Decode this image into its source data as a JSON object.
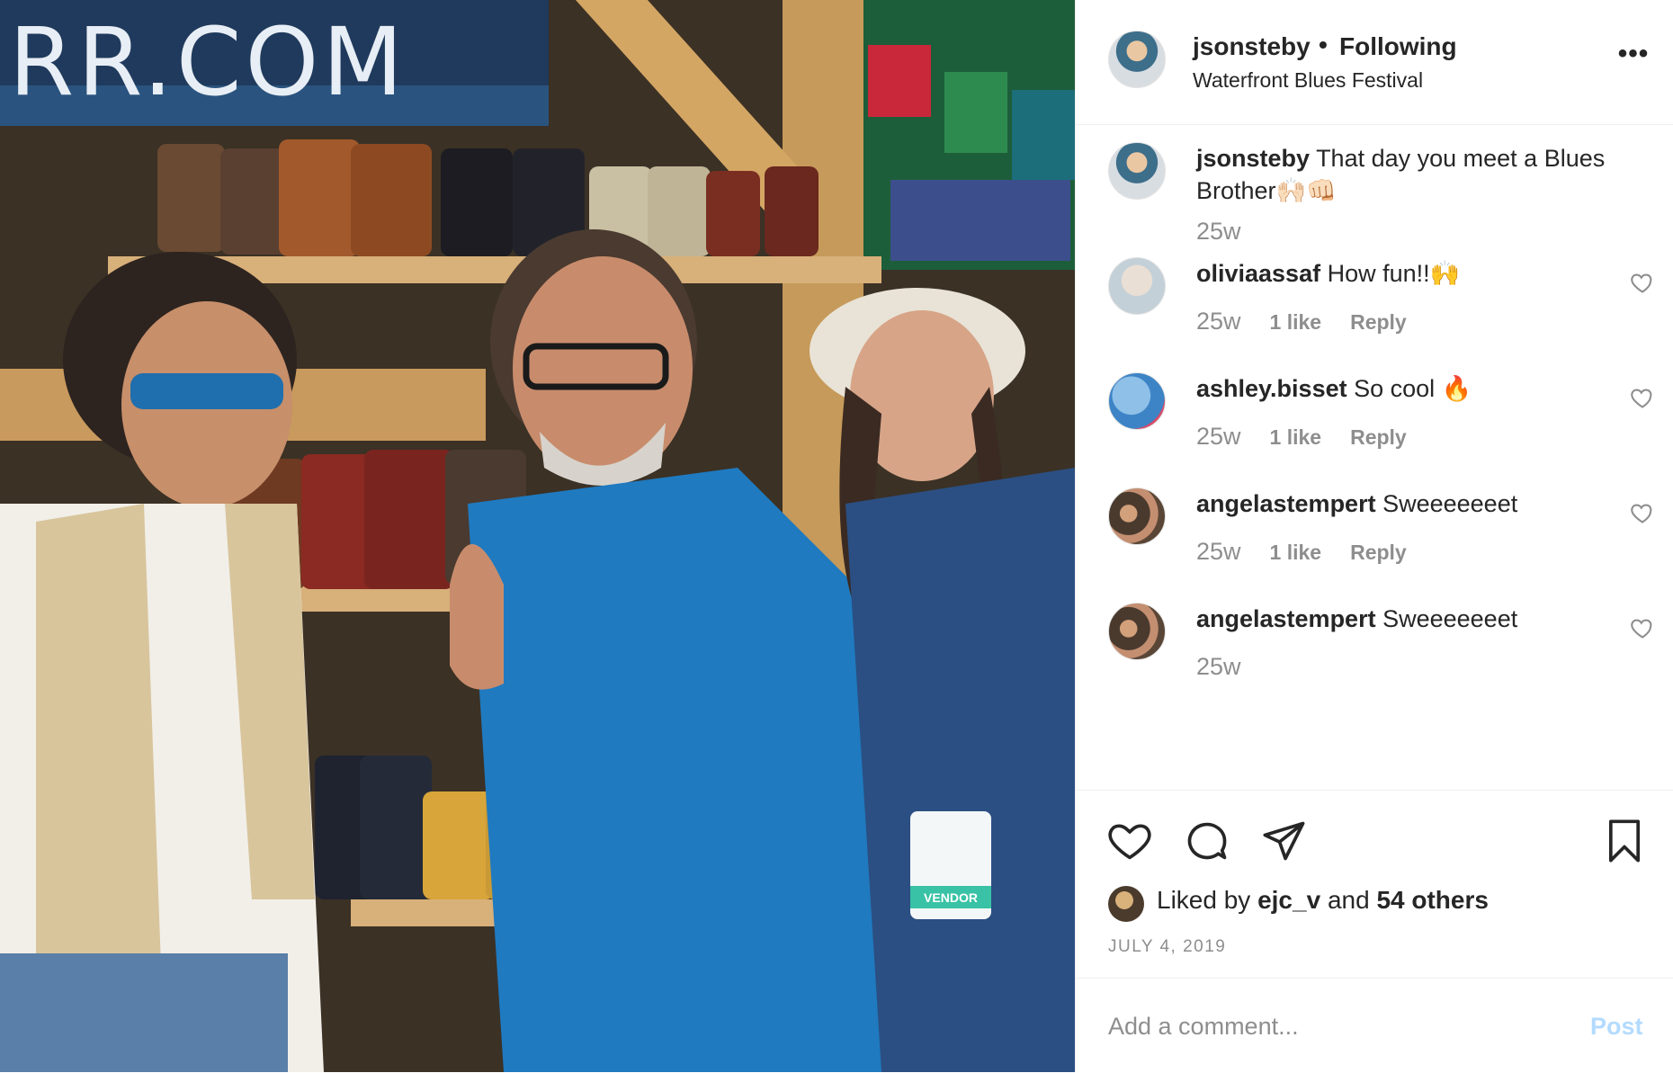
{
  "post": {
    "username": "jsonsteby",
    "separator": "•",
    "following_label": "Following",
    "location": "Waterfront Blues Festival",
    "more_icon": "more-horizontal-icon",
    "more_label": "•••"
  },
  "photo": {
    "sign_text": "RR.COM",
    "badge_text": "VENDOR"
  },
  "caption": {
    "username": "jsonsteby",
    "text": "That day you meet a Blues Brother🙌🏻👊🏻",
    "age": "25w"
  },
  "comments": [
    {
      "username": "oliviaassaf",
      "text": "How fun!!🙌",
      "age": "25w",
      "likes": "1 like",
      "reply": "Reply"
    },
    {
      "username": "ashley.bisset",
      "text": "So cool 🔥",
      "age": "25w",
      "likes": "1 like",
      "reply": "Reply"
    },
    {
      "username": "angelastempert",
      "text": "Sweeeeeeet",
      "age": "25w",
      "likes": "1 like",
      "reply": "Reply"
    },
    {
      "username": "angelastempert",
      "text": "Sweeeeeeet",
      "age": "25w",
      "likes": "",
      "reply": ""
    }
  ],
  "engagement": {
    "liked_by_prefix": "Liked by",
    "liked_by_user": "ejc_v",
    "and": "and",
    "others": "54 others",
    "date": "July 4, 2019"
  },
  "add_comment": {
    "placeholder": "Add a comment...",
    "post_label": "Post"
  },
  "icons": {
    "like": "heart-icon",
    "comment": "comment-icon",
    "share": "share-icon",
    "save": "bookmark-icon"
  },
  "colors": {
    "text": "#262626",
    "secondary": "#8e8e8e",
    "post_button_disabled": "#b3dbff",
    "divider": "#efefef"
  }
}
